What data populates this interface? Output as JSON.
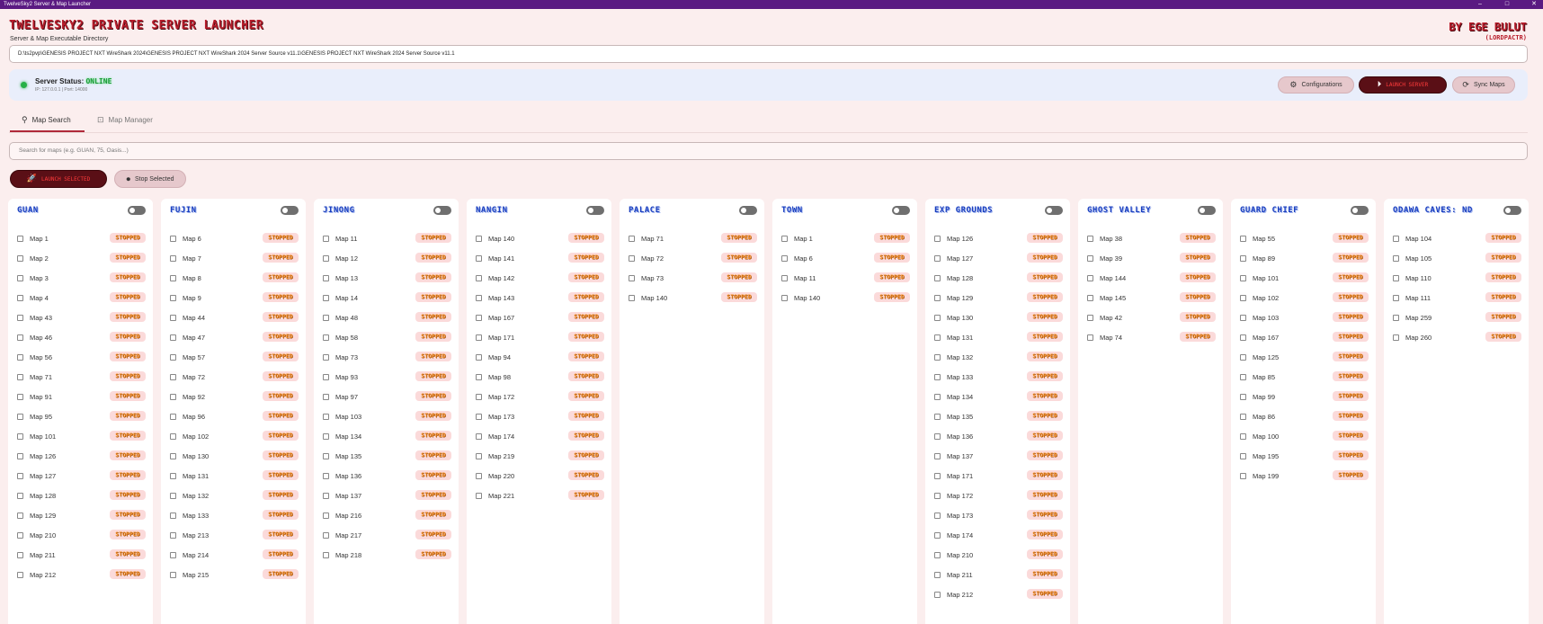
{
  "window": {
    "title": "TwelveSky2 Server & Map Launcher"
  },
  "header": {
    "app_title": "TWELVESKY2 PRIVATE SERVER LAUNCHER",
    "subtitle": "Server & Map Executable Directory",
    "author": "BY EGE BULUT",
    "author_handle": "(LORDPACTR)"
  },
  "path": {
    "value": "D:\\ts2pvp\\GENESIS PROJECT NXT WireShark 2024\\GENESIS PROJECT NXT WireShark 2024 Server Source v11.1\\GENESIS PROJECT NXT WireShark 2024 Server Source v11.1"
  },
  "status": {
    "label": "Server Status:",
    "value": "ONLINE",
    "ip_port": "IP: 127.0.0.1 | Port: 14000",
    "color": "#27b046"
  },
  "buttons": {
    "configurations": "Configurations",
    "launch_server": "LAUNCH SERVER",
    "sync_maps": "Sync Maps",
    "launch_selected": "LAUNCH SELECTED",
    "stop_selected": "Stop Selected"
  },
  "tabs": {
    "search": "Map Search",
    "manager": "Map Manager"
  },
  "search": {
    "placeholder": "Search for maps (e.g. GUAN, 75, Oasis...)"
  },
  "colors": {
    "accent": "#b02a3a",
    "badge_text": "#f28a1c",
    "zone_title": "#1a3fbf"
  },
  "zones": [
    {
      "title": "GUAN",
      "maps": [
        "Map 1",
        "Map 2",
        "Map 3",
        "Map 4",
        "Map 43",
        "Map 46",
        "Map 56",
        "Map 71",
        "Map 91",
        "Map 95",
        "Map 101",
        "Map 126",
        "Map 127",
        "Map 128",
        "Map 129",
        "Map 210",
        "Map 211",
        "Map 212"
      ]
    },
    {
      "title": "FUJIN",
      "maps": [
        "Map 6",
        "Map 7",
        "Map 8",
        "Map 9",
        "Map 44",
        "Map 47",
        "Map 57",
        "Map 72",
        "Map 92",
        "Map 96",
        "Map 102",
        "Map 130",
        "Map 131",
        "Map 132",
        "Map 133",
        "Map 213",
        "Map 214",
        "Map 215"
      ]
    },
    {
      "title": "JINONG",
      "maps": [
        "Map 11",
        "Map 12",
        "Map 13",
        "Map 14",
        "Map 48",
        "Map 58",
        "Map 73",
        "Map 93",
        "Map 97",
        "Map 103",
        "Map 134",
        "Map 135",
        "Map 136",
        "Map 137",
        "Map 216",
        "Map 217",
        "Map 218"
      ]
    },
    {
      "title": "NANGIN",
      "maps": [
        "Map 140",
        "Map 141",
        "Map 142",
        "Map 143",
        "Map 167",
        "Map 171",
        "Map 94",
        "Map 98",
        "Map 172",
        "Map 173",
        "Map 174",
        "Map 219",
        "Map 220",
        "Map 221"
      ]
    },
    {
      "title": "PALACE",
      "maps": [
        "Map 71",
        "Map 72",
        "Map 73",
        "Map 140"
      ]
    },
    {
      "title": "TOWN",
      "maps": [
        "Map 1",
        "Map 6",
        "Map 11",
        "Map 140"
      ]
    },
    {
      "title": "EXP GROUNDS",
      "maps": [
        "Map 126",
        "Map 127",
        "Map 128",
        "Map 129",
        "Map 130",
        "Map 131",
        "Map 132",
        "Map 133",
        "Map 134",
        "Map 135",
        "Map 136",
        "Map 137",
        "Map 171",
        "Map 172",
        "Map 173",
        "Map 174",
        "Map 210",
        "Map 211",
        "Map 212"
      ]
    },
    {
      "title": "GHOST VALLEY",
      "maps": [
        "Map 38",
        "Map 39",
        "Map 144",
        "Map 145",
        "Map 42",
        "Map 74"
      ]
    },
    {
      "title": "GUARD CHIEF",
      "maps": [
        "Map 55",
        "Map 89",
        "Map 101",
        "Map 102",
        "Map 103",
        "Map 167",
        "Map 125",
        "Map 85",
        "Map 99",
        "Map 86",
        "Map 100",
        "Map 195",
        "Map 199"
      ]
    },
    {
      "title": "ODAWA CAVES: ND",
      "maps": [
        "Map 104",
        "Map 105",
        "Map 110",
        "Map 111",
        "Map 259",
        "Map 260"
      ]
    }
  ],
  "badge_text": "STOPPED"
}
